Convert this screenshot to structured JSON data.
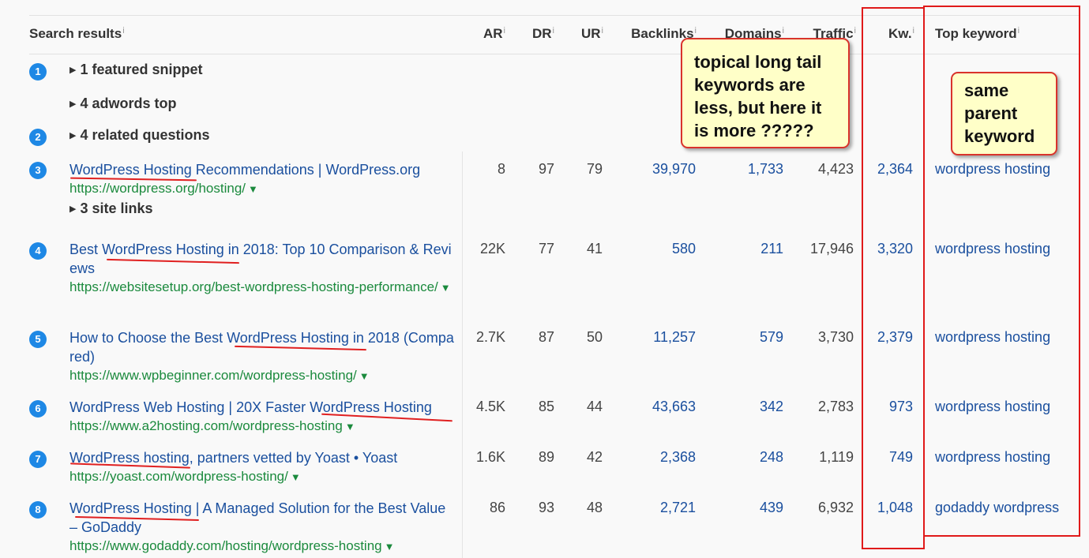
{
  "header": {
    "search_results": "Search results",
    "ar": "AR",
    "dr": "DR",
    "ur": "UR",
    "backlinks": "Backlinks",
    "domains": "Domains",
    "traffic": "Traffic",
    "kw": "Kw.",
    "top_keyword": "Top keyword",
    "info_glyph": "i"
  },
  "features": {
    "featured_snippet": "1 featured snippet",
    "adwords_top": "4 adwords top",
    "related_questions": "4 related questions",
    "site_links": "3 site links"
  },
  "badges": [
    "1",
    "2",
    "3",
    "4",
    "5",
    "6",
    "7",
    "8"
  ],
  "rows": [
    {
      "title": "WordPress Hosting Recommendations | WordPress.org",
      "url": "https://wordpress.org/hosting/",
      "ar": "8",
      "dr": "97",
      "ur": "79",
      "backlinks": "39,970",
      "domains": "1,733",
      "traffic": "4,423",
      "kw": "2,364",
      "top_keyword": "wordpress hosting"
    },
    {
      "title": "Best WordPress Hosting in 2018: Top 10 Comparison & Reviews",
      "url": "https://websitesetup.org/best-wordpress-hosting-performance/",
      "ar": "22K",
      "dr": "77",
      "ur": "41",
      "backlinks": "580",
      "domains": "211",
      "traffic": "17,946",
      "kw": "3,320",
      "top_keyword": "wordpress hosting"
    },
    {
      "title": "How to Choose the Best WordPress Hosting in 2018 (Compared)",
      "url": "https://www.wpbeginner.com/wordpress-hosting/",
      "ar": "2.7K",
      "dr": "87",
      "ur": "50",
      "backlinks": "11,257",
      "domains": "579",
      "traffic": "3,730",
      "kw": "2,379",
      "top_keyword": "wordpress hosting"
    },
    {
      "title": "WordPress Web Hosting | 20X Faster WordPress Hosting",
      "url": "https://www.a2hosting.com/wordpress-hosting",
      "ar": "4.5K",
      "dr": "85",
      "ur": "44",
      "backlinks": "43,663",
      "domains": "342",
      "traffic": "2,783",
      "kw": "973",
      "top_keyword": "wordpress hosting"
    },
    {
      "title": "WordPress hosting, partners vetted by Yoast • Yoast",
      "url": "https://yoast.com/wordpress-hosting/",
      "ar": "1.6K",
      "dr": "89",
      "ur": "42",
      "backlinks": "2,368",
      "domains": "248",
      "traffic": "1,119",
      "kw": "749",
      "top_keyword": "wordpress hosting"
    },
    {
      "title": "WordPress Hosting | A Managed Solution for the Best Value – GoDaddy",
      "url": "https://www.godaddy.com/hosting/wordpress-hosting",
      "ar": "86",
      "dr": "93",
      "ur": "48",
      "backlinks": "2,721",
      "domains": "439",
      "traffic": "6,932",
      "kw": "1,048",
      "top_keyword": "godaddy wordpress"
    }
  ],
  "annotations": {
    "note_topical": "topical long tail keywords are less, but here it is more ?????",
    "note_parent": "same parent keyword"
  },
  "colors": {
    "link_blue": "#1a4f9e",
    "url_green": "#1b8a3d",
    "badge_blue": "#1e88e5",
    "annotation_red": "#e01a1a",
    "note_bg": "#ffffc8"
  }
}
